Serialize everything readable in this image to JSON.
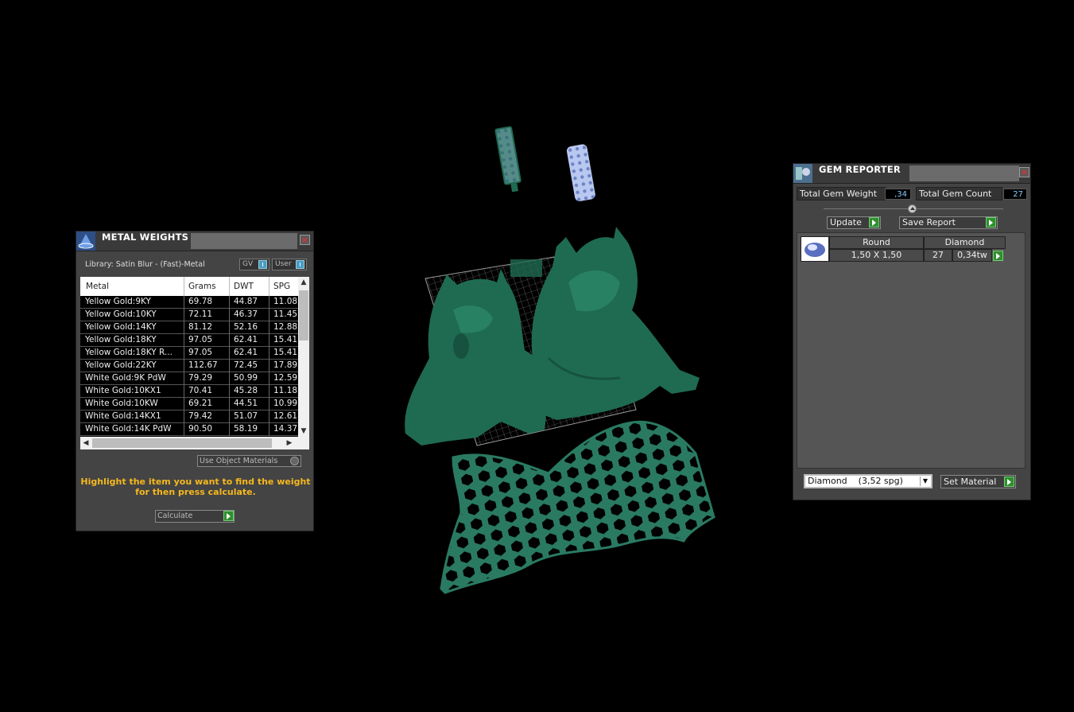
{
  "metal_weights": {
    "title": "METAL WEIGHTS",
    "library": "Library: Satin Blur - (Fast)-Metal",
    "toggle_gv": "GV",
    "toggle_user": "User",
    "columns": [
      "Metal",
      "Grams",
      "DWT",
      "SPG"
    ],
    "rows": [
      {
        "metal": "Yellow Gold:9KY",
        "grams": "69.78",
        "dwt": "44.87",
        "spg": "11.08"
      },
      {
        "metal": "Yellow Gold:10KY",
        "grams": "72.11",
        "dwt": "46.37",
        "spg": "11.45"
      },
      {
        "metal": "Yellow Gold:14KY",
        "grams": "81.12",
        "dwt": "52.16",
        "spg": "12.88"
      },
      {
        "metal": "Yellow Gold:18KY",
        "grams": "97.05",
        "dwt": "62.41",
        "spg": "15.41"
      },
      {
        "metal": "Yellow Gold:18KY R...",
        "grams": "97.05",
        "dwt": "62.41",
        "spg": "15.41"
      },
      {
        "metal": "Yellow Gold:22KY",
        "grams": "112.67",
        "dwt": "72.45",
        "spg": "17.89"
      },
      {
        "metal": "White Gold:9K PdW",
        "grams": "79.29",
        "dwt": "50.99",
        "spg": "12.59"
      },
      {
        "metal": "White Gold:10KX1",
        "grams": "70.41",
        "dwt": "45.28",
        "spg": "11.18"
      },
      {
        "metal": "White Gold:10KW",
        "grams": "69.21",
        "dwt": "44.51",
        "spg": "10.99"
      },
      {
        "metal": "White Gold:14KX1",
        "grams": "79.42",
        "dwt": "51.07",
        "spg": "12.61"
      },
      {
        "metal": "White Gold:14K PdW",
        "grams": "90.50",
        "dwt": "58.19",
        "spg": "14.37"
      }
    ],
    "use_object_materials": "Use Object Materials",
    "hint": "Highlight the item you want to find the weight for then press calculate.",
    "calculate_label": "Calculate"
  },
  "gem_reporter": {
    "title": "GEM REPORTER",
    "total_weight_label": "Total Gem Weight",
    "total_weight_value": ",34",
    "total_count_label": "Total Gem Count",
    "total_count_value": "27",
    "update_label": "Update",
    "save_report_label": "Save Report",
    "gems": [
      {
        "shape": "Round",
        "size": "1,50 X 1,50",
        "material": "Diamond",
        "count": "27",
        "weight": "0,34tw"
      }
    ],
    "material_select": "Diamond    (3,52 spg)",
    "set_material_label": "Set Material"
  },
  "colors": {
    "model": "#1f6b52",
    "accent": "#f5b81e",
    "go": "#2f8f2f"
  }
}
